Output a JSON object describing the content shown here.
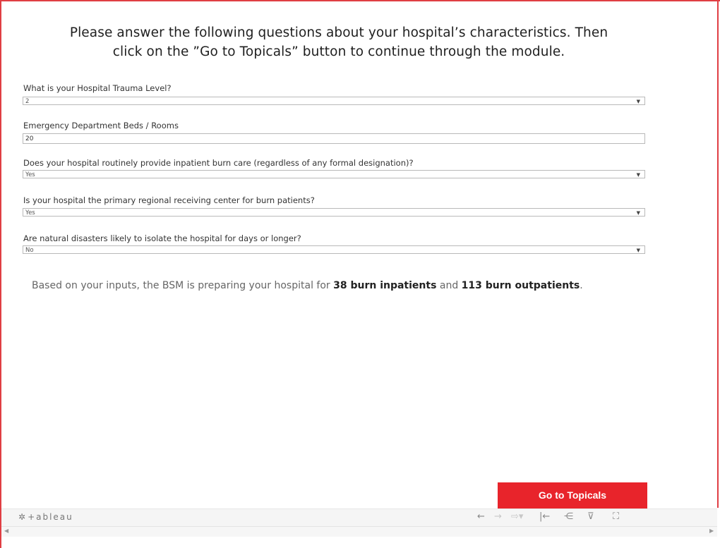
{
  "heading": {
    "line1": "Please answer the following questions about your hospital’s characteristics. Then",
    "line2": "click on the ”Go to Topicals” button to continue through the module."
  },
  "questions": [
    {
      "label": "What is your Hospital Trauma Level?",
      "value": "2",
      "type": "dropdown"
    },
    {
      "label": "Emergency Department Beds / Rooms",
      "value": "20",
      "type": "text"
    },
    {
      "label": "Does your hospital routinely provide inpatient burn care (regardless of any formal designation)?",
      "value": "Yes",
      "type": "dropdown"
    },
    {
      "label": "Is your hospital the primary regional receiving center for burn patients?",
      "value": "Yes",
      "type": "dropdown"
    },
    {
      "label": "Are natural disasters likely to isolate the hospital for days or longer?",
      "value": "No",
      "type": "dropdown"
    }
  ],
  "summary": {
    "prefix": "Based on your inputs, the BSM is preparing your hospital for",
    "inpatients": "38 burn inpatients",
    "conjunction": "and",
    "outpatients": "113 burn outpatients",
    "suffix": "."
  },
  "button": {
    "label": "Go to Topicals"
  },
  "toolbar": {
    "logo_text": "+ableau",
    "icons": [
      "undo-icon",
      "redo-icon",
      "revert-icon",
      "reset-icon",
      "share-icon",
      "download-icon",
      "fullscreen-icon"
    ]
  },
  "colors": {
    "accent": "#e8242b",
    "frame": "#e03e43"
  }
}
